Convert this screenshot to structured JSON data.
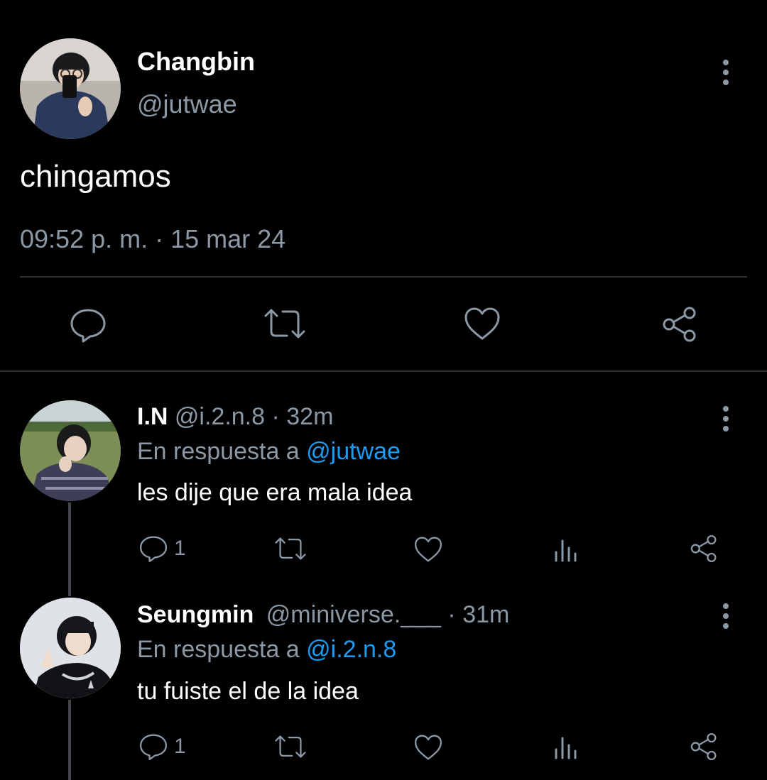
{
  "main_tweet": {
    "name": "Changbin",
    "handle": "@jutwae",
    "text": "chingamos",
    "timestamp": "09:52 p. m. · 15 mar 24",
    "avatar_icon": "profile-photo",
    "actions": [
      "reply-icon",
      "retweet-icon",
      "like-icon",
      "share-icon"
    ]
  },
  "replies": [
    {
      "name": "I.N",
      "handle": "@i.2.n.8",
      "time": "· 32m",
      "reply_prefix": "En respuesta a",
      "reply_to": "@jutwae",
      "text": "les dije que era mala idea",
      "reply_count": "1"
    },
    {
      "name": "Seungmin",
      "handle": "@miniverse.___",
      "time": "· 31m",
      "reply_prefix": "En respuesta a",
      "reply_to": "@i.2.n.8",
      "text": "tu fuiste el de la idea",
      "reply_count": "1"
    }
  ],
  "colors": {
    "background": "#000000",
    "primary_text": "#ffffff",
    "secondary_text": "#8b98a5",
    "link": "#1d9bf0",
    "divider": "#2f3336"
  }
}
